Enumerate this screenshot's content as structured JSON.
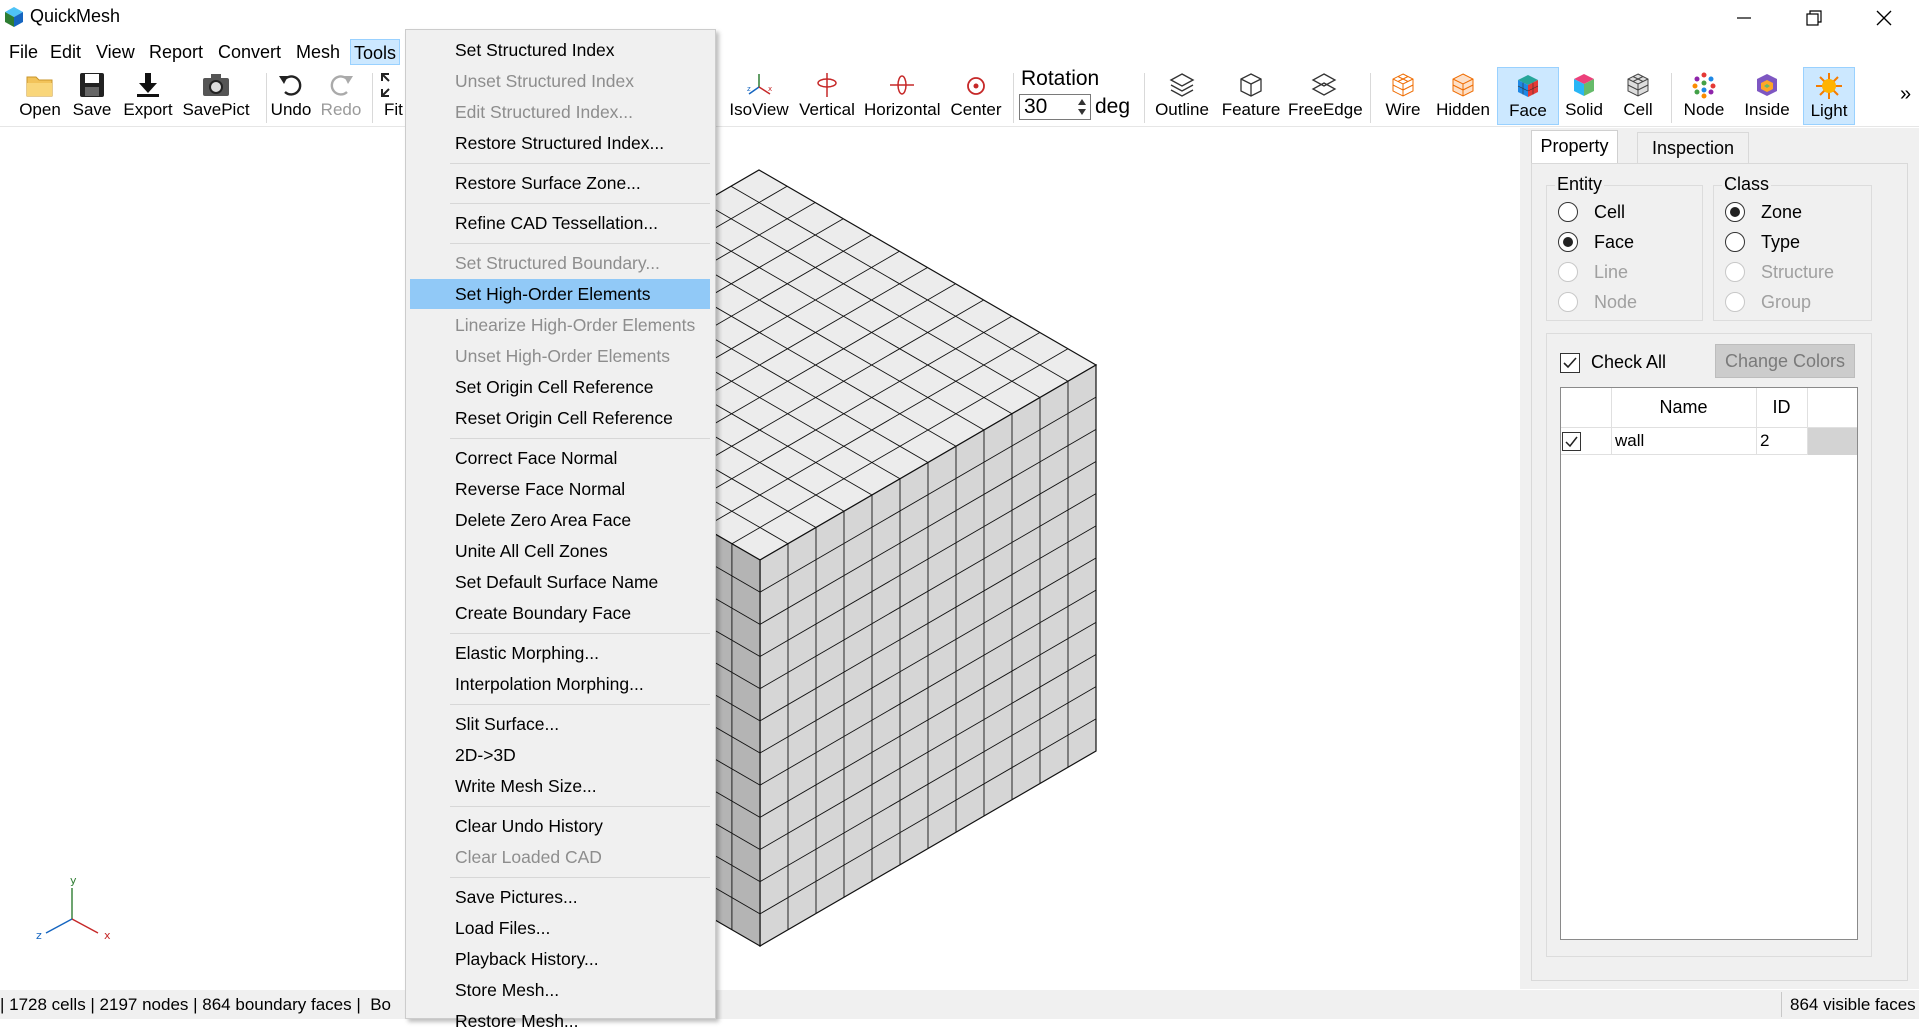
{
  "app": {
    "title": "QuickMesh"
  },
  "menubar": {
    "items": [
      {
        "label": "File"
      },
      {
        "label": "Edit"
      },
      {
        "label": "View"
      },
      {
        "label": "Report"
      },
      {
        "label": "Convert"
      },
      {
        "label": "Mesh"
      },
      {
        "label": "Tools"
      }
    ],
    "active": "Tools"
  },
  "toolbar": {
    "open": "Open",
    "save": "Save",
    "export": "Export",
    "savepict": "SavePict",
    "undo": "Undo",
    "redo": "Redo",
    "fit": "Fit",
    "isoview": "IsoView",
    "vertical": "Vertical",
    "horizontal": "Horizontal",
    "center": "Center",
    "rotation_label": "Rotation",
    "rotation_value": "30",
    "rotation_unit": "deg",
    "outline": "Outline",
    "feature": "Feature",
    "freeedge": "FreeEdge",
    "wire": "Wire",
    "hidden": "Hidden",
    "face": "Face",
    "solid": "Solid",
    "cell": "Cell",
    "node": "Node",
    "inside": "Inside",
    "light": "Light",
    "overflow": "»"
  },
  "tools_menu": {
    "items": [
      {
        "label": "Set Structured Index",
        "enabled": true
      },
      {
        "label": "Unset Structured Index",
        "enabled": false
      },
      {
        "label": "Edit Structured Index...",
        "enabled": false
      },
      {
        "label": "Restore Structured Index...",
        "enabled": true
      },
      {
        "label": "Restore Surface Zone...",
        "enabled": true
      },
      {
        "label": "Refine CAD Tessellation...",
        "enabled": true
      },
      {
        "label": "Set Structured Boundary...",
        "enabled": false
      },
      {
        "label": "Set High-Order Elements",
        "enabled": true,
        "highlighted": true
      },
      {
        "label": "Linearize High-Order Elements",
        "enabled": false
      },
      {
        "label": "Unset High-Order Elements",
        "enabled": false
      },
      {
        "label": "Set Origin Cell Reference",
        "enabled": true
      },
      {
        "label": "Reset Origin Cell Reference",
        "enabled": true
      },
      {
        "label": "Correct Face Normal",
        "enabled": true
      },
      {
        "label": "Reverse Face Normal",
        "enabled": true
      },
      {
        "label": "Delete Zero Area Face",
        "enabled": true
      },
      {
        "label": "Unite All Cell Zones",
        "enabled": true
      },
      {
        "label": "Set Default Surface Name",
        "enabled": true
      },
      {
        "label": "Create Boundary Face",
        "enabled": true
      },
      {
        "label": "Elastic Morphing...",
        "enabled": true
      },
      {
        "label": "Interpolation Morphing...",
        "enabled": true
      },
      {
        "label": "Slit Surface...",
        "enabled": true
      },
      {
        "label": "2D->3D",
        "enabled": true
      },
      {
        "label": "Write Mesh Size...",
        "enabled": true
      },
      {
        "label": "Clear Undo History",
        "enabled": true
      },
      {
        "label": "Clear Loaded CAD",
        "enabled": false
      },
      {
        "label": "Save Pictures...",
        "enabled": true
      },
      {
        "label": "Load Files...",
        "enabled": true
      },
      {
        "label": "Playback History...",
        "enabled": true
      },
      {
        "label": "Store Mesh...",
        "enabled": true
      },
      {
        "label": "Restore Mesh...",
        "enabled": true
      }
    ]
  },
  "panel": {
    "tabs": [
      "Property",
      "Inspection"
    ],
    "active_tab": "Property",
    "entity": {
      "title": "Entity",
      "options": [
        {
          "label": "Cell",
          "checked": false,
          "enabled": true
        },
        {
          "label": "Face",
          "checked": true,
          "enabled": true
        },
        {
          "label": "Line",
          "checked": false,
          "enabled": false
        },
        {
          "label": "Node",
          "checked": false,
          "enabled": false
        }
      ]
    },
    "class": {
      "title": "Class",
      "options": [
        {
          "label": "Zone",
          "checked": true,
          "enabled": true
        },
        {
          "label": "Type",
          "checked": false,
          "enabled": true
        },
        {
          "label": "Structure",
          "checked": false,
          "enabled": false
        },
        {
          "label": "Group",
          "checked": false,
          "enabled": false
        }
      ]
    },
    "check_all": {
      "label": "Check All",
      "checked": true
    },
    "change_colors": "Change Colors",
    "table": {
      "columns": [
        "Name",
        "ID"
      ],
      "rows": [
        {
          "checked": true,
          "name": "wall",
          "id": "2"
        }
      ]
    }
  },
  "axes": {
    "x": "x",
    "y": "y",
    "z": "z"
  },
  "status": {
    "left": "| 1728 cells | 2197 nodes | 864 boundary faces |  Bo",
    "right": "864 visible faces"
  }
}
